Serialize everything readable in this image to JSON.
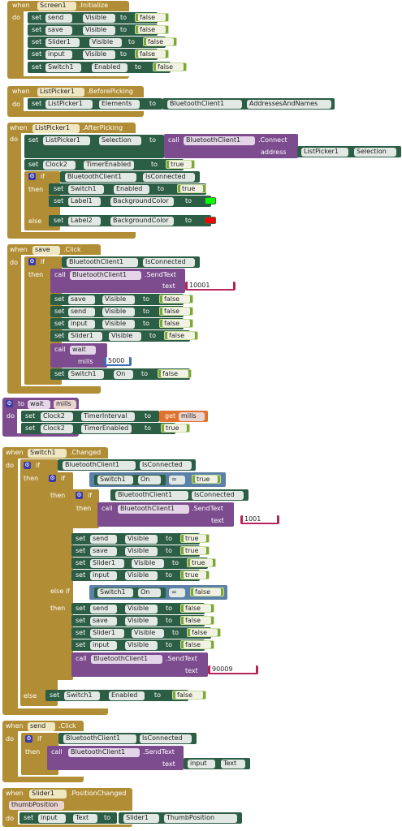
{
  "colors": {
    "event": "#b18e35",
    "setter": "#2c5d45",
    "procedure": "#7c4c8e",
    "logic": "#5c81a6",
    "boolean": "#7aa63a",
    "number": "#3b6fb5",
    "text": "#b6235a",
    "green_swatch": "#00ff00",
    "red_swatch": "#ff0000"
  },
  "kw": {
    "when": "when",
    "do": "do",
    "set": "set",
    "to": "to",
    "if": "if",
    "then": "then",
    "else": "else",
    "else_if": "else if",
    "call": "call",
    "address": "address",
    "text": "text",
    "mills": "mills",
    "get": "get",
    "eq": "="
  },
  "comp": {
    "screen1": "Screen1",
    "listpicker1": "ListPicker1",
    "save": "save",
    "switch1": "Switch1",
    "send": "send",
    "slider1": "Slider1",
    "input": "input",
    "clock2": "Clock2",
    "bt": "BluetoothClient1",
    "label1": "Label1",
    "label2": "Label2",
    "wait": "wait"
  },
  "evt": {
    "initialize": ".Initialize",
    "before": ".BeforePicking",
    "after": ".AfterPicking",
    "click": ".Click",
    "changed": ".Changed",
    "poschanged": ".PositionChanged"
  },
  "prop": {
    "visible": "Visible",
    "enabled": "Enabled",
    "elements": "Elements",
    "selection": "Selection",
    "timer_enabled": "TimerEnabled",
    "is_connected": "IsConnected",
    "bg": "BackgroundColor",
    "on": "On",
    "timer_interval": "TimerInterval",
    "text": "Text",
    "thumb": "ThumbPosition",
    "addresses": "AddressesAndNames"
  },
  "method": {
    "connect": ".Connect",
    "sendtext": ".SendText"
  },
  "val": {
    "false": "false",
    "true": "true",
    "t10001": "10001",
    "n5000": "5000",
    "t1001": "1001",
    "t90009": "90009"
  },
  "param": {
    "mills": "mills",
    "thumbposition": "thumbPosition"
  }
}
